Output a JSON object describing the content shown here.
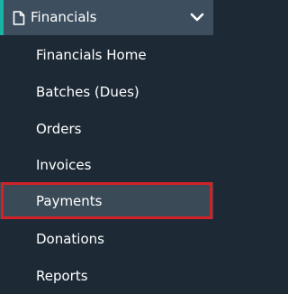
{
  "section": {
    "title": "Financials",
    "icon": "document-icon",
    "chevron": "chevron-down-icon",
    "accent_color": "#18b3a4"
  },
  "menu": {
    "items": [
      {
        "label": "Financials Home"
      },
      {
        "label": "Batches (Dues)"
      },
      {
        "label": "Orders"
      },
      {
        "label": "Invoices"
      },
      {
        "label": "Payments",
        "active": true
      },
      {
        "label": "Donations"
      },
      {
        "label": "Reports"
      }
    ]
  },
  "highlight": {
    "target": "Payments",
    "color": "#d32128"
  }
}
